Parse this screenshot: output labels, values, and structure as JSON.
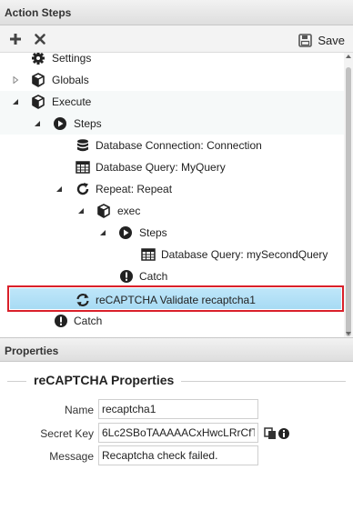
{
  "action_steps": {
    "header": "Action Steps",
    "toolbar": {
      "add_icon": "plus-icon",
      "delete_icon": "close-icon",
      "save_icon": "save-icon",
      "save_label": "Save"
    },
    "tree": [
      {
        "label": "Settings",
        "icon": "gear-icon"
      },
      {
        "label": "Globals",
        "icon": "cube-icon",
        "state": "collapsed"
      },
      {
        "label": "Execute",
        "icon": "cube-icon",
        "state": "expanded"
      },
      {
        "label": "Steps",
        "icon": "play-circle-icon",
        "state": "expanded"
      },
      {
        "label": "Database Connection: Connection",
        "icon": "database-icon"
      },
      {
        "label": "Database Query: MyQuery",
        "icon": "table-icon"
      },
      {
        "label": "Repeat: Repeat",
        "icon": "repeat-icon",
        "state": "expanded"
      },
      {
        "label": "exec",
        "icon": "cube-icon",
        "state": "expanded"
      },
      {
        "label": "Steps",
        "icon": "play-circle-icon",
        "state": "expanded"
      },
      {
        "label": "Database Query: mySecondQuery",
        "icon": "table-icon"
      },
      {
        "label": "Catch",
        "icon": "exclamation-circle-icon"
      },
      {
        "label": "reCAPTCHA Validate recaptcha1",
        "icon": "refresh-icon",
        "selected": true
      },
      {
        "label": "Catch",
        "icon": "exclamation-circle-icon"
      }
    ]
  },
  "properties": {
    "header": "Properties",
    "section_title": "reCAPTCHA Properties",
    "fields": [
      {
        "label": "Name",
        "value": "recaptcha1"
      },
      {
        "label": "Secret Key",
        "value": "6Lc2SBoTAAAAACxHwcLRrCfT"
      },
      {
        "label": "Message",
        "value": "Recaptcha check failed."
      }
    ],
    "secret_key_icons": [
      "copy-icon",
      "info-icon"
    ]
  },
  "colors": {
    "selection_fill": "#a8dbf4",
    "highlight_border": "#d9202a",
    "header_bg": "#e6e6e6"
  }
}
